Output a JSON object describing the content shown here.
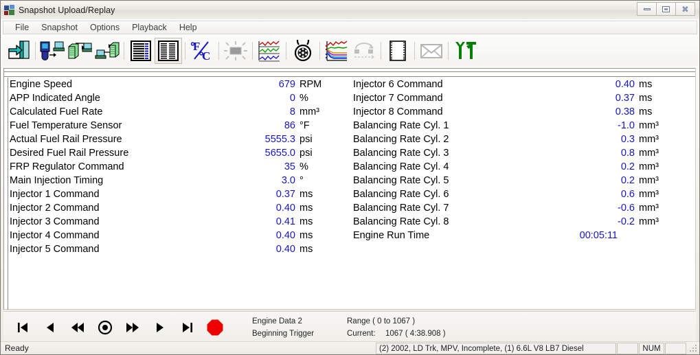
{
  "window": {
    "title": "Snapshot Upload/Replay",
    "icon": "app-icon",
    "minimize_label": "Minimize",
    "maximize_label": "Maximize",
    "close_label": "Close"
  },
  "menu": {
    "items": [
      {
        "label": "File",
        "name": "menu-file"
      },
      {
        "label": "Snapshot",
        "name": "menu-snapshot"
      },
      {
        "label": "Options",
        "name": "menu-options"
      },
      {
        "label": "Playback",
        "name": "menu-playback"
      },
      {
        "label": "Help",
        "name": "menu-help"
      }
    ]
  },
  "toolbar": {
    "buttons": [
      {
        "name": "exit-door-icon",
        "title": "Exit",
        "enabled": true,
        "pressed": false
      },
      {
        "name": "tool-to-pc-upload-icon",
        "title": "Upload from tool to PC",
        "enabled": true,
        "pressed": false
      },
      {
        "name": "server-to-pc-icon",
        "title": "Download from server",
        "enabled": true,
        "pressed": false
      },
      {
        "name": "pc-to-server-icon",
        "title": "Upload to server",
        "enabled": true,
        "pressed": false
      },
      {
        "name": "list-view-icon",
        "title": "List view",
        "enabled": true,
        "pressed": false
      },
      {
        "name": "grid-view-icon",
        "title": "Grid view",
        "enabled": true,
        "pressed": true
      },
      {
        "name": "fahrenheit-celsius-icon",
        "title": "Units F/C",
        "enabled": true,
        "pressed": false
      },
      {
        "name": "lamp-icon",
        "title": "Highlight",
        "enabled": false,
        "pressed": false
      },
      {
        "name": "multi-graph-icon",
        "title": "Multiple graphs",
        "enabled": true,
        "pressed": false
      },
      {
        "name": "gauge-icon",
        "title": "Gauge view",
        "enabled": true,
        "pressed": false
      },
      {
        "name": "overlay-graph-icon",
        "title": "Overlay graph",
        "enabled": true,
        "pressed": false
      },
      {
        "name": "movie-replay-icon",
        "title": "Replay",
        "enabled": false,
        "pressed": false
      },
      {
        "name": "print-page-icon",
        "title": "Print",
        "enabled": true,
        "pressed": false
      },
      {
        "name": "email-icon",
        "title": "E-mail",
        "enabled": false,
        "pressed": false
      },
      {
        "name": "tools-icon",
        "title": "Tools",
        "enabled": true,
        "pressed": false
      }
    ]
  },
  "data": {
    "left_column": [
      {
        "label": "Engine Speed",
        "value": "679",
        "unit": "RPM"
      },
      {
        "label": "APP Indicated Angle",
        "value": "0",
        "unit": "%"
      },
      {
        "label": "Calculated Fuel Rate",
        "value": "8",
        "unit": "mm³"
      },
      {
        "label": "Fuel Temperature Sensor",
        "value": "86",
        "unit": "°F"
      },
      {
        "label": "Actual Fuel Rail Pressure",
        "value": "5555.3",
        "unit": "psi"
      },
      {
        "label": "Desired Fuel Rail Pressure",
        "value": "5655.0",
        "unit": "psi"
      },
      {
        "label": "FRP Regulator Command",
        "value": "35",
        "unit": "%"
      },
      {
        "label": "Main Injection Timing",
        "value": "3.0",
        "unit": "°"
      },
      {
        "label": "Injector 1 Command",
        "value": "0.37",
        "unit": "ms"
      },
      {
        "label": "Injector 2 Command",
        "value": "0.40",
        "unit": "ms"
      },
      {
        "label": "Injector 3 Command",
        "value": "0.41",
        "unit": "ms"
      },
      {
        "label": "Injector 4 Command",
        "value": "0.40",
        "unit": "ms"
      },
      {
        "label": "Injector 5 Command",
        "value": "0.40",
        "unit": "ms"
      }
    ],
    "right_column": [
      {
        "label": "Injector 6 Command",
        "value": "0.40",
        "unit": "ms"
      },
      {
        "label": "Injector 7 Command",
        "value": "0.37",
        "unit": "ms"
      },
      {
        "label": "Injector 8 Command",
        "value": "0.38",
        "unit": "ms"
      },
      {
        "label": "Balancing Rate Cyl. 1",
        "value": "-1.0",
        "unit": "mm³"
      },
      {
        "label": "Balancing Rate Cyl. 2",
        "value": "0.3",
        "unit": "mm³"
      },
      {
        "label": "Balancing Rate Cyl. 3",
        "value": "0.8",
        "unit": "mm³"
      },
      {
        "label": "Balancing Rate Cyl. 4",
        "value": "0.2",
        "unit": "mm³"
      },
      {
        "label": "Balancing Rate Cyl. 5",
        "value": "0.2",
        "unit": "mm³"
      },
      {
        "label": "Balancing Rate Cyl. 6",
        "value": "0.6",
        "unit": "mm³"
      },
      {
        "label": "Balancing Rate Cyl. 7",
        "value": "-0.6",
        "unit": "mm³"
      },
      {
        "label": "Balancing Rate Cyl. 8",
        "value": "-0.2",
        "unit": "mm³"
      },
      {
        "label": "Engine Run Time",
        "value": "00:05:11",
        "unit": ""
      }
    ]
  },
  "transport": {
    "buttons": [
      {
        "name": "go-to-start-button",
        "title": "Go to start"
      },
      {
        "name": "step-back-button",
        "title": "Step back"
      },
      {
        "name": "rewind-button",
        "title": "Rewind"
      },
      {
        "name": "trigger-button",
        "title": "Trigger point"
      },
      {
        "name": "fast-forward-button",
        "title": "Fast forward"
      },
      {
        "name": "step-forward-button",
        "title": "Step forward"
      },
      {
        "name": "go-to-end-button",
        "title": "Go to end"
      },
      {
        "name": "record-button",
        "title": "Record"
      }
    ],
    "dataset_name": "Engine Data 2",
    "trigger_label": "Beginning Trigger",
    "range_label": "Range ( 0 to 1067 )",
    "current_label": "Current:",
    "current_value": "1067 ( 4:38.908 )"
  },
  "statusbar": {
    "ready": "Ready",
    "vehicle": "(2) 2002, LD Trk, MPV, Incomplete, (1) 6.6L   V8 LB7 Diesel",
    "pane_1": "",
    "num_indicator": "NUM",
    "pane_3": ""
  },
  "colors": {
    "value_blue": "#1414c8",
    "record_red": "#ee0000",
    "tool_green": "#008000",
    "label_black": "#000000"
  }
}
